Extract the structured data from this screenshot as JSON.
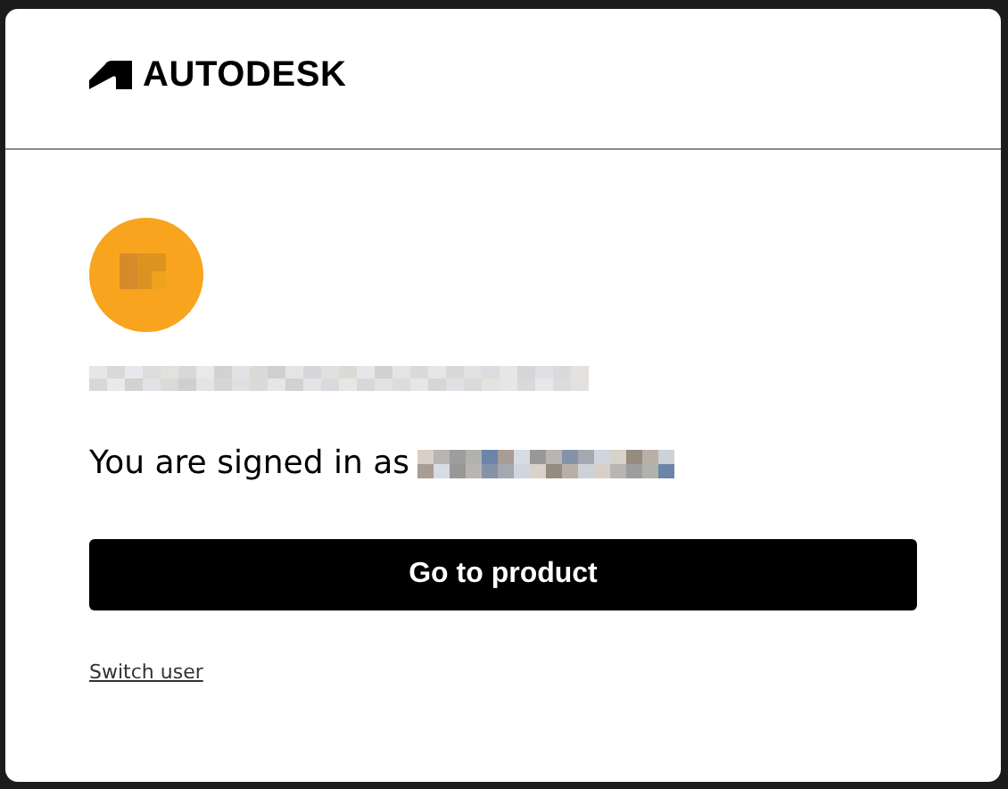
{
  "header": {
    "logo_text": "AUTODESK"
  },
  "account": {
    "signed_in_label": "You are signed in as"
  },
  "primary_button": {
    "label": "Go to product"
  },
  "switch_link": {
    "label": "Switch user"
  }
}
